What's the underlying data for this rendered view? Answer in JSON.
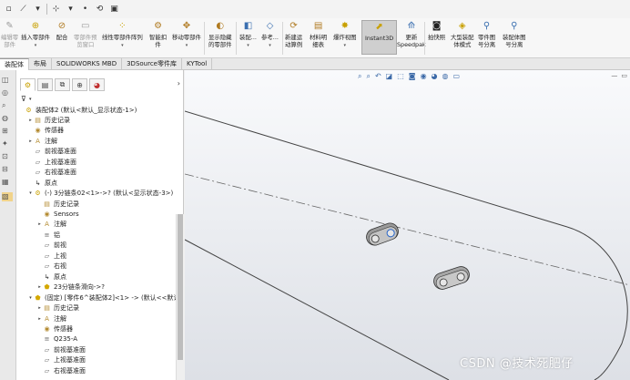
{
  "ribbon": {
    "buttons": [
      {
        "label1": "编辑零",
        "label2": "部件",
        "icon": "edit-part-icon",
        "disabled": true
      },
      {
        "label1": "插入零部件",
        "label2": "",
        "icon": "insert-component-icon",
        "disabled": false
      },
      {
        "label1": "配合",
        "label2": "",
        "icon": "mate-icon",
        "disabled": false
      },
      {
        "label1": "零部件预",
        "label2": "览窗口",
        "icon": "component-preview-icon",
        "disabled": true
      },
      {
        "label1": "线性零部件阵列",
        "label2": "",
        "icon": "linear-pattern-icon",
        "disabled": false
      },
      {
        "label1": "智能扣",
        "label2": "件",
        "icon": "smart-fastener-icon",
        "disabled": false
      },
      {
        "label1": "移动零部件",
        "label2": "",
        "icon": "move-component-icon",
        "disabled": false
      },
      {
        "label1": "显示隐藏",
        "label2": "的零部件",
        "icon": "show-hidden-icon",
        "disabled": false
      },
      {
        "label1": "装配...",
        "label2": "",
        "icon": "assembly-features-icon",
        "disabled": false
      },
      {
        "label1": "参考...",
        "label2": "",
        "icon": "reference-geometry-icon",
        "disabled": false
      },
      {
        "label1": "新建运",
        "label2": "动算例",
        "icon": "new-motion-study-icon",
        "disabled": false
      },
      {
        "label1": "材料明",
        "label2": "细表",
        "icon": "bill-of-materials-icon",
        "disabled": false
      },
      {
        "label1": "爆炸视图",
        "label2": "",
        "icon": "exploded-view-icon",
        "disabled": false
      },
      {
        "label1": "Instant3D",
        "label2": "",
        "icon": "instant3d-icon",
        "disabled": false
      },
      {
        "label1": "更新",
        "label2": "Speedpak",
        "icon": "speedpak-icon",
        "disabled": false
      },
      {
        "label1": "拍快照",
        "label2": "",
        "icon": "snapshot-icon",
        "disabled": false
      },
      {
        "label1": "大型装配",
        "label2": "体模式",
        "icon": "large-assembly-icon",
        "disabled": false
      },
      {
        "label1": "零件图",
        "label2": "号分离",
        "icon": "part-number-separate-icon",
        "disabled": false
      },
      {
        "label1": "装配体图",
        "label2": "号分离",
        "icon": "assembly-number-separate-icon",
        "disabled": false
      }
    ]
  },
  "tabs": [
    "装配体",
    "布局",
    "SOLIDWORKS MBD",
    "3DSource零件库",
    "KYTool"
  ],
  "tree": {
    "rows": [
      {
        "text": "装配体2 (默认<默认_显示状态-1>)",
        "icon": "assembly-icon",
        "exp": "",
        "indent": 0
      },
      {
        "text": "历史记录",
        "icon": "history-icon",
        "exp": "▸",
        "indent": 1
      },
      {
        "text": "传感器",
        "icon": "sensor-icon",
        "exp": "",
        "indent": 1
      },
      {
        "text": "注解",
        "icon": "annotation-icon",
        "exp": "▸",
        "indent": 1
      },
      {
        "text": "前视基准面",
        "icon": "plane-icon",
        "exp": "",
        "indent": 1
      },
      {
        "text": "上视基准面",
        "icon": "plane-icon",
        "exp": "",
        "indent": 1
      },
      {
        "text": "右视基准面",
        "icon": "plane-icon",
        "exp": "",
        "indent": 1
      },
      {
        "text": "原点",
        "icon": "origin-icon",
        "exp": "",
        "indent": 1
      },
      {
        "text": "(-) 3分链条02<1>->? (默认<显示状态-3>)",
        "icon": "subassembly-icon",
        "exp": "▾",
        "indent": 1
      },
      {
        "text": "历史记录",
        "icon": "history-icon",
        "exp": "",
        "indent": 2
      },
      {
        "text": "Sensors",
        "icon": "sensor-icon",
        "exp": "",
        "indent": 2
      },
      {
        "text": "注解",
        "icon": "annotation-icon",
        "exp": "▸",
        "indent": 2
      },
      {
        "text": "铝",
        "icon": "material-icon",
        "exp": "",
        "indent": 2
      },
      {
        "text": "前视",
        "icon": "plane-icon",
        "exp": "",
        "indent": 2
      },
      {
        "text": "上视",
        "icon": "plane-icon",
        "exp": "",
        "indent": 2
      },
      {
        "text": "右视",
        "icon": "plane-icon",
        "exp": "",
        "indent": 2
      },
      {
        "text": "原点",
        "icon": "origin-icon",
        "exp": "",
        "indent": 2
      },
      {
        "text": "23分链条滑向->?",
        "icon": "part-icon",
        "exp": "▸",
        "indent": 2
      },
      {
        "text": "(固定) [零件6^装配体2]<1> -> (默认<<默认",
        "icon": "part-icon",
        "exp": "▾",
        "indent": 1
      },
      {
        "text": "历史记录",
        "icon": "history-icon",
        "exp": "▸",
        "indent": 2
      },
      {
        "text": "注解",
        "icon": "annotation-icon",
        "exp": "▸",
        "indent": 2
      },
      {
        "text": "传感器",
        "icon": "sensor-icon",
        "exp": "",
        "indent": 2
      },
      {
        "text": "Q235-A",
        "icon": "material-icon",
        "exp": "",
        "indent": 2
      },
      {
        "text": "前视基准面",
        "icon": "plane-icon",
        "exp": "",
        "indent": 2
      },
      {
        "text": "上视基准面",
        "icon": "plane-icon",
        "exp": "",
        "indent": 2
      },
      {
        "text": "右视基准面",
        "icon": "plane-icon",
        "exp": "",
        "indent": 2
      }
    ]
  },
  "watermark": "CSDN @技术死肥仔"
}
